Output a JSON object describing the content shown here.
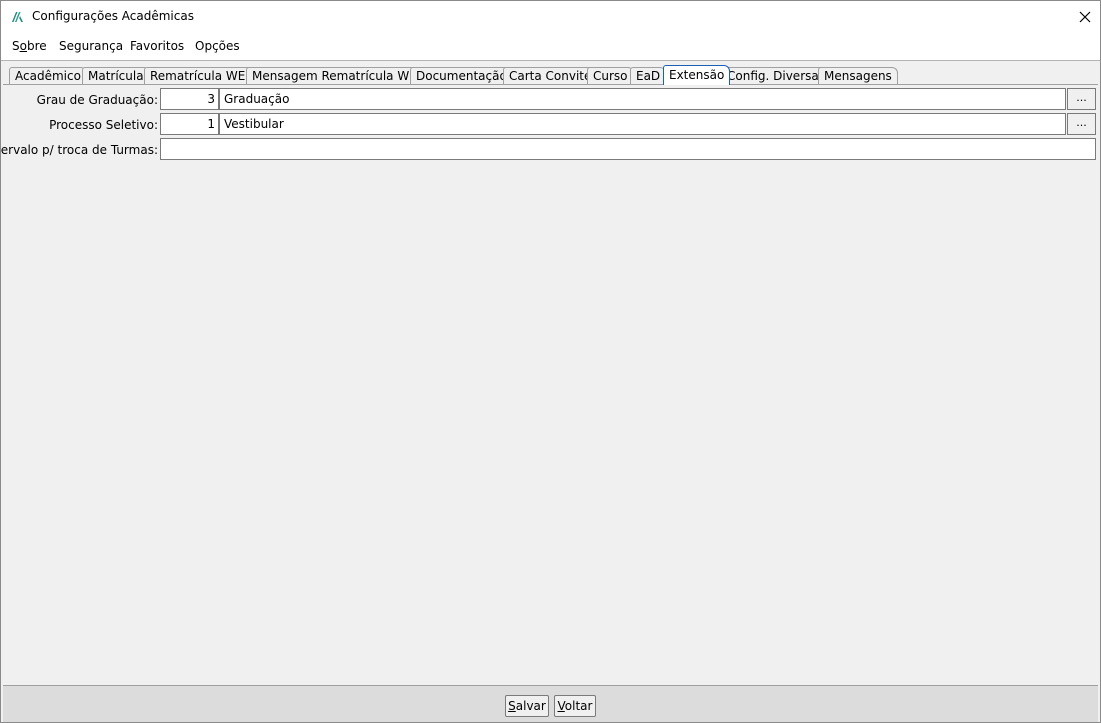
{
  "window": {
    "title": "Configurações Acadêmicas"
  },
  "menu": {
    "items": [
      "Sobre",
      "Segurança",
      "Favoritos",
      "Opções"
    ]
  },
  "tabs": [
    "Acadêmico",
    "Matrícula",
    "Rematrícula WEB",
    "Mensagem Rematrícula WEB",
    "Documentação",
    "Carta Convite",
    "Curso",
    "EaD",
    "Extensão",
    "Config. Diversas",
    "Mensagens"
  ],
  "active_tab": "Extensão",
  "form": {
    "grau": {
      "label": "Grau de Graduação:",
      "code": "3",
      "description": "Graduação",
      "button": "..."
    },
    "processo": {
      "label": "Processo Seletivo:",
      "code": "1",
      "description": "Vestibular",
      "button": "..."
    },
    "intervalo": {
      "label": "Intervalo p/ troca de Turmas:",
      "value": ""
    }
  },
  "buttons": {
    "save": "Salvar",
    "back": "Voltar"
  },
  "colors": {
    "active_tab_border": "#1a5fb4",
    "app_icon": "#1f8a7a"
  }
}
